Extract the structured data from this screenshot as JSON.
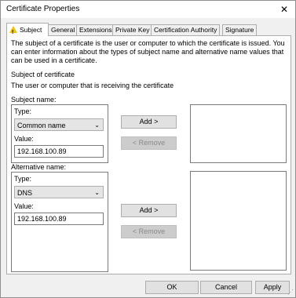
{
  "window": {
    "title": "Certificate Properties"
  },
  "icons": {
    "close": "close-icon",
    "subject_tab": "warning-icon",
    "dropdown": "chevron-down-icon"
  },
  "tabs": [
    {
      "label": "Subject",
      "active": true
    },
    {
      "label": "General"
    },
    {
      "label": "Extensions"
    },
    {
      "label": "Private Key"
    },
    {
      "label": "Certification Authority"
    },
    {
      "label": "Signature"
    }
  ],
  "description": "The subject of a certificate is the user or computer to which the certificate is issued. You can enter information about the types of subject name and alternative name values that can be used in a certificate.",
  "subject_section": {
    "heading": "Subject of certificate",
    "subheading": "The user or computer that is receiving the certificate"
  },
  "subject_name": {
    "label": "Subject name:",
    "type_label": "Type:",
    "type_value": "Common name",
    "value_label": "Value:",
    "value": "192.168.100.89",
    "add_button": "Add >",
    "remove_button": "< Remove"
  },
  "alternative_name": {
    "label": "Alternative name:",
    "type_label": "Type:",
    "type_value": "DNS",
    "value_label": "Value:",
    "value": "192.168.100.89",
    "add_button": "Add >",
    "remove_button": "< Remove"
  },
  "footer": {
    "ok": "OK",
    "cancel": "Cancel",
    "apply": "Apply"
  }
}
